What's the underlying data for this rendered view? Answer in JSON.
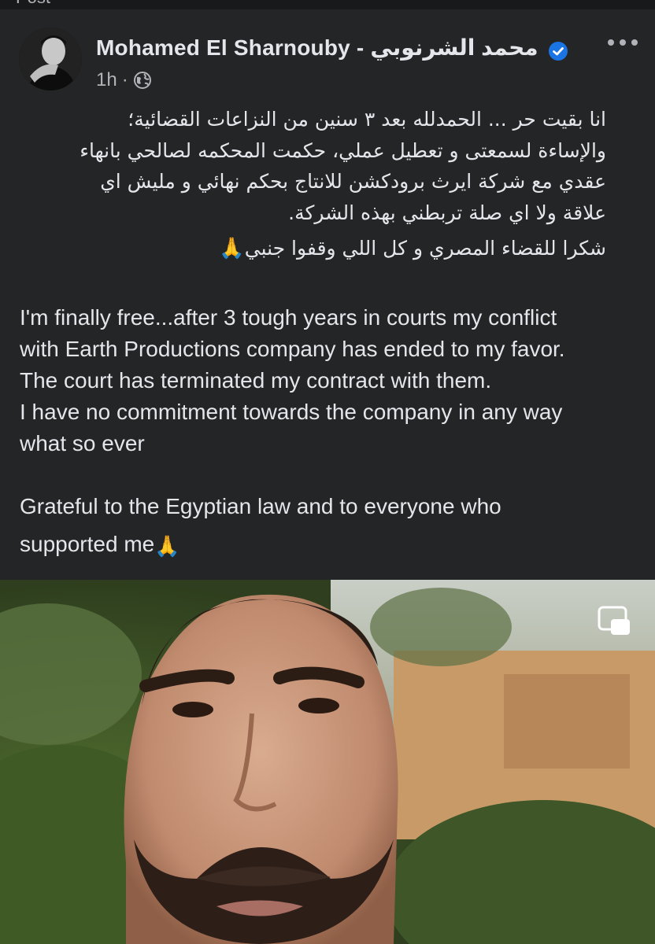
{
  "previous_header_fragment": "Post",
  "post": {
    "author": "Mohamed El Sharnouby - محمد الشرنوبي",
    "time": "1h",
    "separator": "·",
    "icons": {
      "verified": "verified-badge-icon",
      "more": "more-options-icon",
      "audience": "globe-icon",
      "pip": "picture-in-picture-icon"
    },
    "colors": {
      "verified": "#1b74e4",
      "background": "#242526",
      "text": "#e4e6eb",
      "meta": "#b0b3b8"
    },
    "arabic_lines": [
      "انا بقيت حر ... الحمدلله بعد ٣ سنين من النزاعات  القضائية؛",
      "والإساءة لسمعتى و تعطيل عملي، حكمت المحكمه لصالحي بانهاء",
      "عقدي مع شركة ايرث برودكشن للانتاج بحكم  نهائي و مليش اي",
      "علاقة ولا اي صلة تربطني بهذه الشركة."
    ],
    "arabic_thanks": "شكرا للقضاء المصري و كل اللي وقفوا جنبي",
    "english_lines": [
      "I'm finally free...after 3 tough years in courts my conflict",
      "with Earth Productions company has ended to my favor.",
      "The court has terminated my contract with them.",
      "I have no commitment towards the company in any way",
      "what so ever"
    ],
    "english_thanks_line1": "Grateful to the Egyptian law and to everyone who",
    "english_thanks_line2": "supported me",
    "emoji": "🙏"
  }
}
